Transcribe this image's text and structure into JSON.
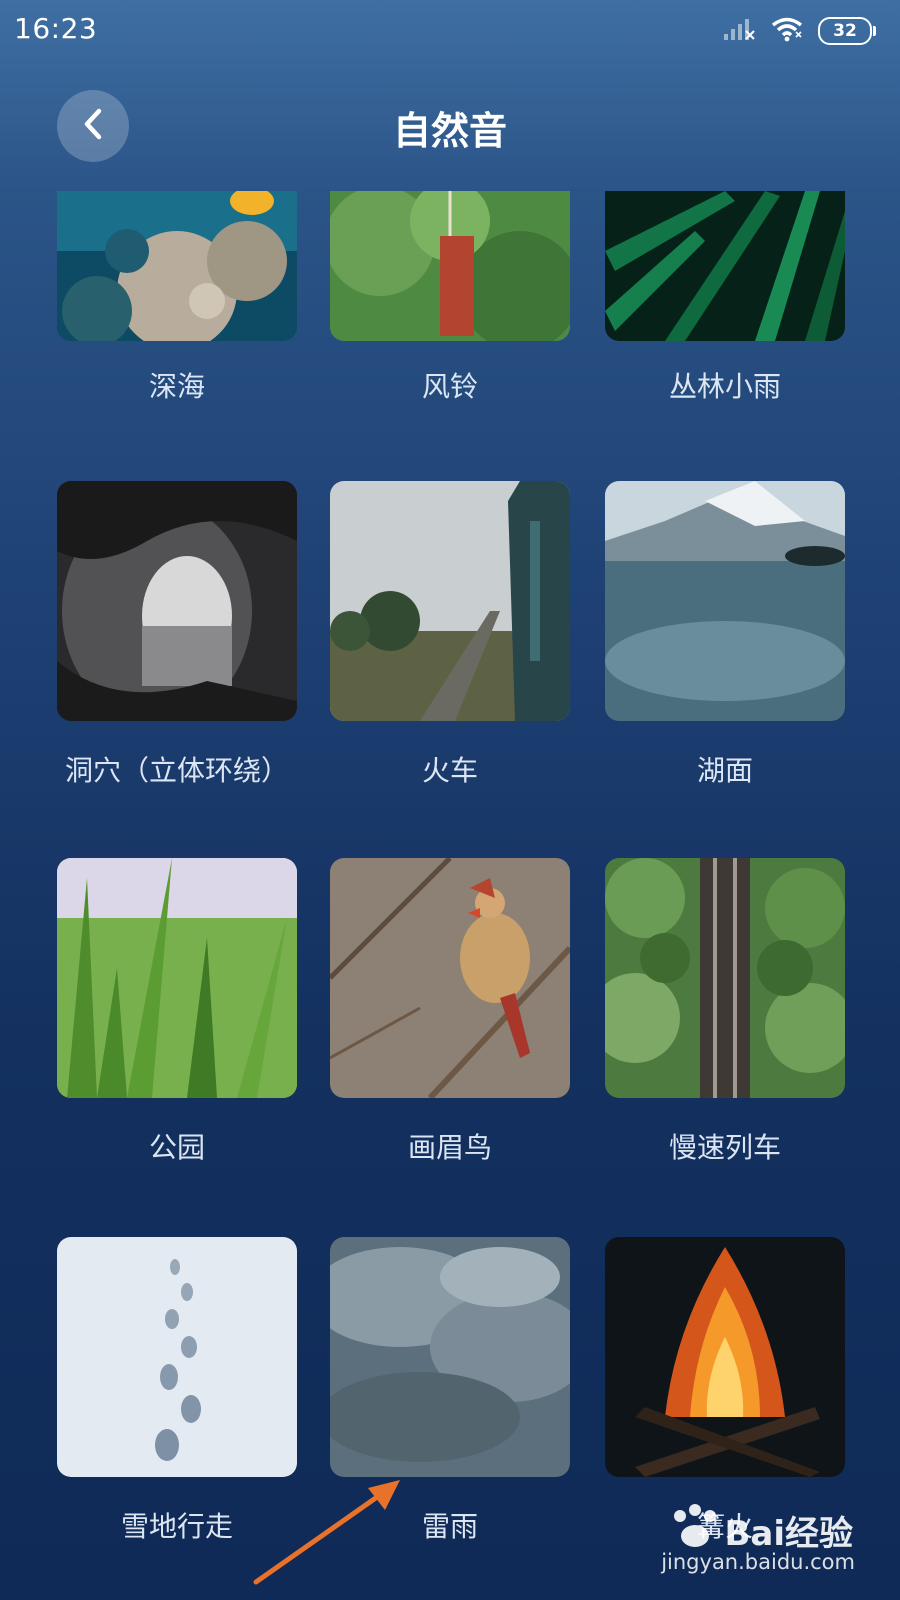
{
  "status_bar": {
    "time": "16:23",
    "battery": "32"
  },
  "header": {
    "title": "自然音"
  },
  "tiles": [
    {
      "label": "深海"
    },
    {
      "label": "风铃"
    },
    {
      "label": "丛林小雨"
    },
    {
      "label": "洞穴（立体环绕）"
    },
    {
      "label": "火车"
    },
    {
      "label": "湖面"
    },
    {
      "label": "公园"
    },
    {
      "label": "画眉鸟"
    },
    {
      "label": "慢速列车"
    },
    {
      "label": "雪地行走"
    },
    {
      "label": "雷雨"
    },
    {
      "label": "篝火"
    }
  ],
  "watermark": {
    "brand": "Bai经验",
    "url": "jingyan.baidu.com"
  },
  "icons": {
    "back": "chevron-left-icon",
    "signal": "cellular-signal-off-icon",
    "wifi": "wifi-icon",
    "battery": "battery-icon"
  },
  "colors": {
    "accent_arrow": "#e8722a",
    "background_top": "#3f6fa3",
    "background_bottom": "#0f2a56"
  }
}
